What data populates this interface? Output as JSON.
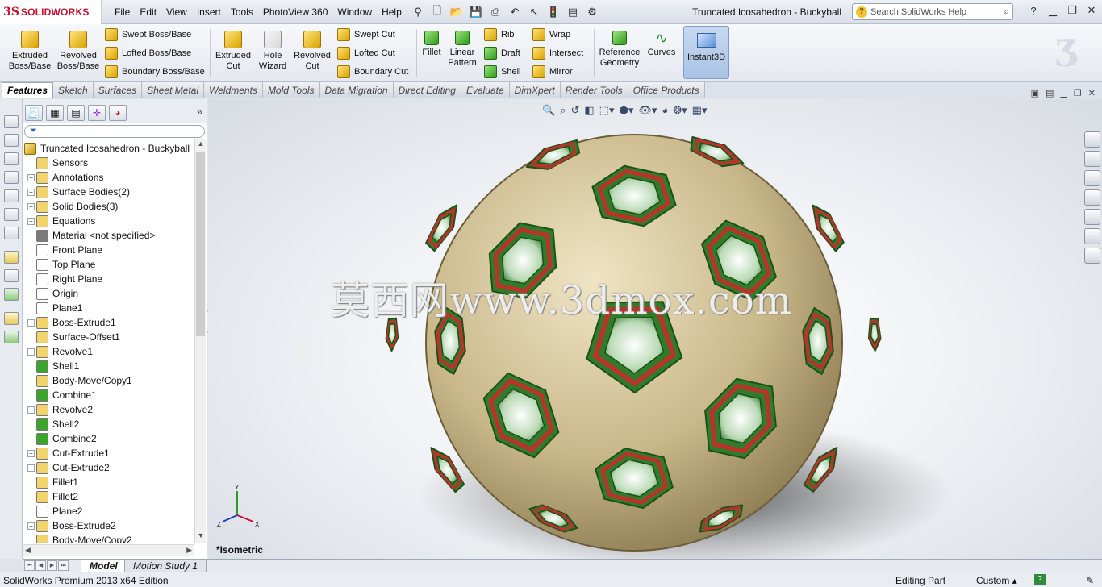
{
  "app": {
    "brand_ds": "3S",
    "brand_name": "SOLIDWORKS"
  },
  "menu": [
    "File",
    "Edit",
    "View",
    "Insert",
    "Tools",
    "PhotoView 360",
    "Window",
    "Help"
  ],
  "window_title": "Truncated Icosahedron - Buckyball",
  "search": {
    "placeholder": "Search SolidWorks Help"
  },
  "ribbon": {
    "extruded_boss": "Extruded\nBoss/Base",
    "revolved_boss": "Revolved\nBoss/Base",
    "swept_boss": "Swept Boss/Base",
    "lofted_boss": "Lofted Boss/Base",
    "boundary_boss": "Boundary Boss/Base",
    "extruded_cut": "Extruded\nCut",
    "hole_wizard": "Hole\nWizard",
    "revolved_cut": "Revolved\nCut",
    "swept_cut": "Swept Cut",
    "lofted_cut": "Lofted Cut",
    "boundary_cut": "Boundary Cut",
    "fillet": "Fillet",
    "linear_pattern": "Linear\nPattern",
    "rib": "Rib",
    "draft": "Draft",
    "shell": "Shell",
    "wrap": "Wrap",
    "intersect": "Intersect",
    "mirror": "Mirror",
    "reference_geometry": "Reference\nGeometry",
    "curves": "Curves",
    "instant3d": "Instant3D"
  },
  "tabs": [
    "Features",
    "Sketch",
    "Surfaces",
    "Sheet Metal",
    "Weldments",
    "Mold Tools",
    "Data Migration",
    "Direct Editing",
    "Evaluate",
    "DimXpert",
    "Render Tools",
    "Office Products"
  ],
  "tree": {
    "root": "Truncated Icosahedron - Buckyball",
    "items": [
      {
        "label": "Sensors",
        "exp": false,
        "color": "#f3d36b"
      },
      {
        "label": "Annotations",
        "exp": true,
        "color": "#f3d36b"
      },
      {
        "label": "Surface Bodies(2)",
        "exp": true,
        "color": "#f3d36b"
      },
      {
        "label": "Solid Bodies(3)",
        "exp": true,
        "color": "#f3d36b"
      },
      {
        "label": "Equations",
        "exp": true,
        "color": "#f3d36b"
      },
      {
        "label": "Material <not specified>",
        "exp": false,
        "color": "#7a7a7a"
      },
      {
        "label": "Front Plane",
        "exp": false,
        "color": "#ffffff"
      },
      {
        "label": "Top Plane",
        "exp": false,
        "color": "#ffffff"
      },
      {
        "label": "Right Plane",
        "exp": false,
        "color": "#ffffff"
      },
      {
        "label": "Origin",
        "exp": false,
        "color": "#ffffff"
      },
      {
        "label": "Plane1",
        "exp": false,
        "color": "#ffffff"
      },
      {
        "label": "Boss-Extrude1",
        "exp": true,
        "color": "#f3d36b"
      },
      {
        "label": "Surface-Offset1",
        "exp": false,
        "color": "#f3d36b"
      },
      {
        "label": "Revolve1",
        "exp": true,
        "color": "#f3d36b"
      },
      {
        "label": "Shell1",
        "exp": false,
        "color": "#3aa52a"
      },
      {
        "label": "Body-Move/Copy1",
        "exp": false,
        "color": "#f3d36b"
      },
      {
        "label": "Combine1",
        "exp": false,
        "color": "#3aa52a"
      },
      {
        "label": "Revolve2",
        "exp": true,
        "color": "#f3d36b"
      },
      {
        "label": "Shell2",
        "exp": false,
        "color": "#3aa52a"
      },
      {
        "label": "Combine2",
        "exp": false,
        "color": "#3aa52a"
      },
      {
        "label": "Cut-Extrude1",
        "exp": true,
        "color": "#f3d36b"
      },
      {
        "label": "Cut-Extrude2",
        "exp": true,
        "color": "#f3d36b"
      },
      {
        "label": "Fillet1",
        "exp": false,
        "color": "#f3d36b"
      },
      {
        "label": "Fillet2",
        "exp": false,
        "color": "#f3d36b"
      },
      {
        "label": "Plane2",
        "exp": false,
        "color": "#ffffff"
      },
      {
        "label": "Boss-Extrude2",
        "exp": true,
        "color": "#f3d36b"
      },
      {
        "label": "Body-Move/Copy2",
        "exp": false,
        "color": "#f3d36b"
      }
    ]
  },
  "viewport": {
    "watermark": "莫西网www.3dmox.com",
    "view_label": "*Isometric",
    "triad": {
      "x": "X",
      "y": "Y",
      "z": "Z"
    }
  },
  "bottom_tabs": [
    "Model",
    "Motion Study 1"
  ],
  "status": {
    "edition": "SolidWorks Premium 2013 x64 Edition",
    "mode": "Editing Part",
    "units": "Custom",
    "help": "?"
  },
  "colors": {
    "shell": "#cdbd92",
    "frame_green": "#2f7d2a",
    "frame_red": "#b8342a"
  }
}
